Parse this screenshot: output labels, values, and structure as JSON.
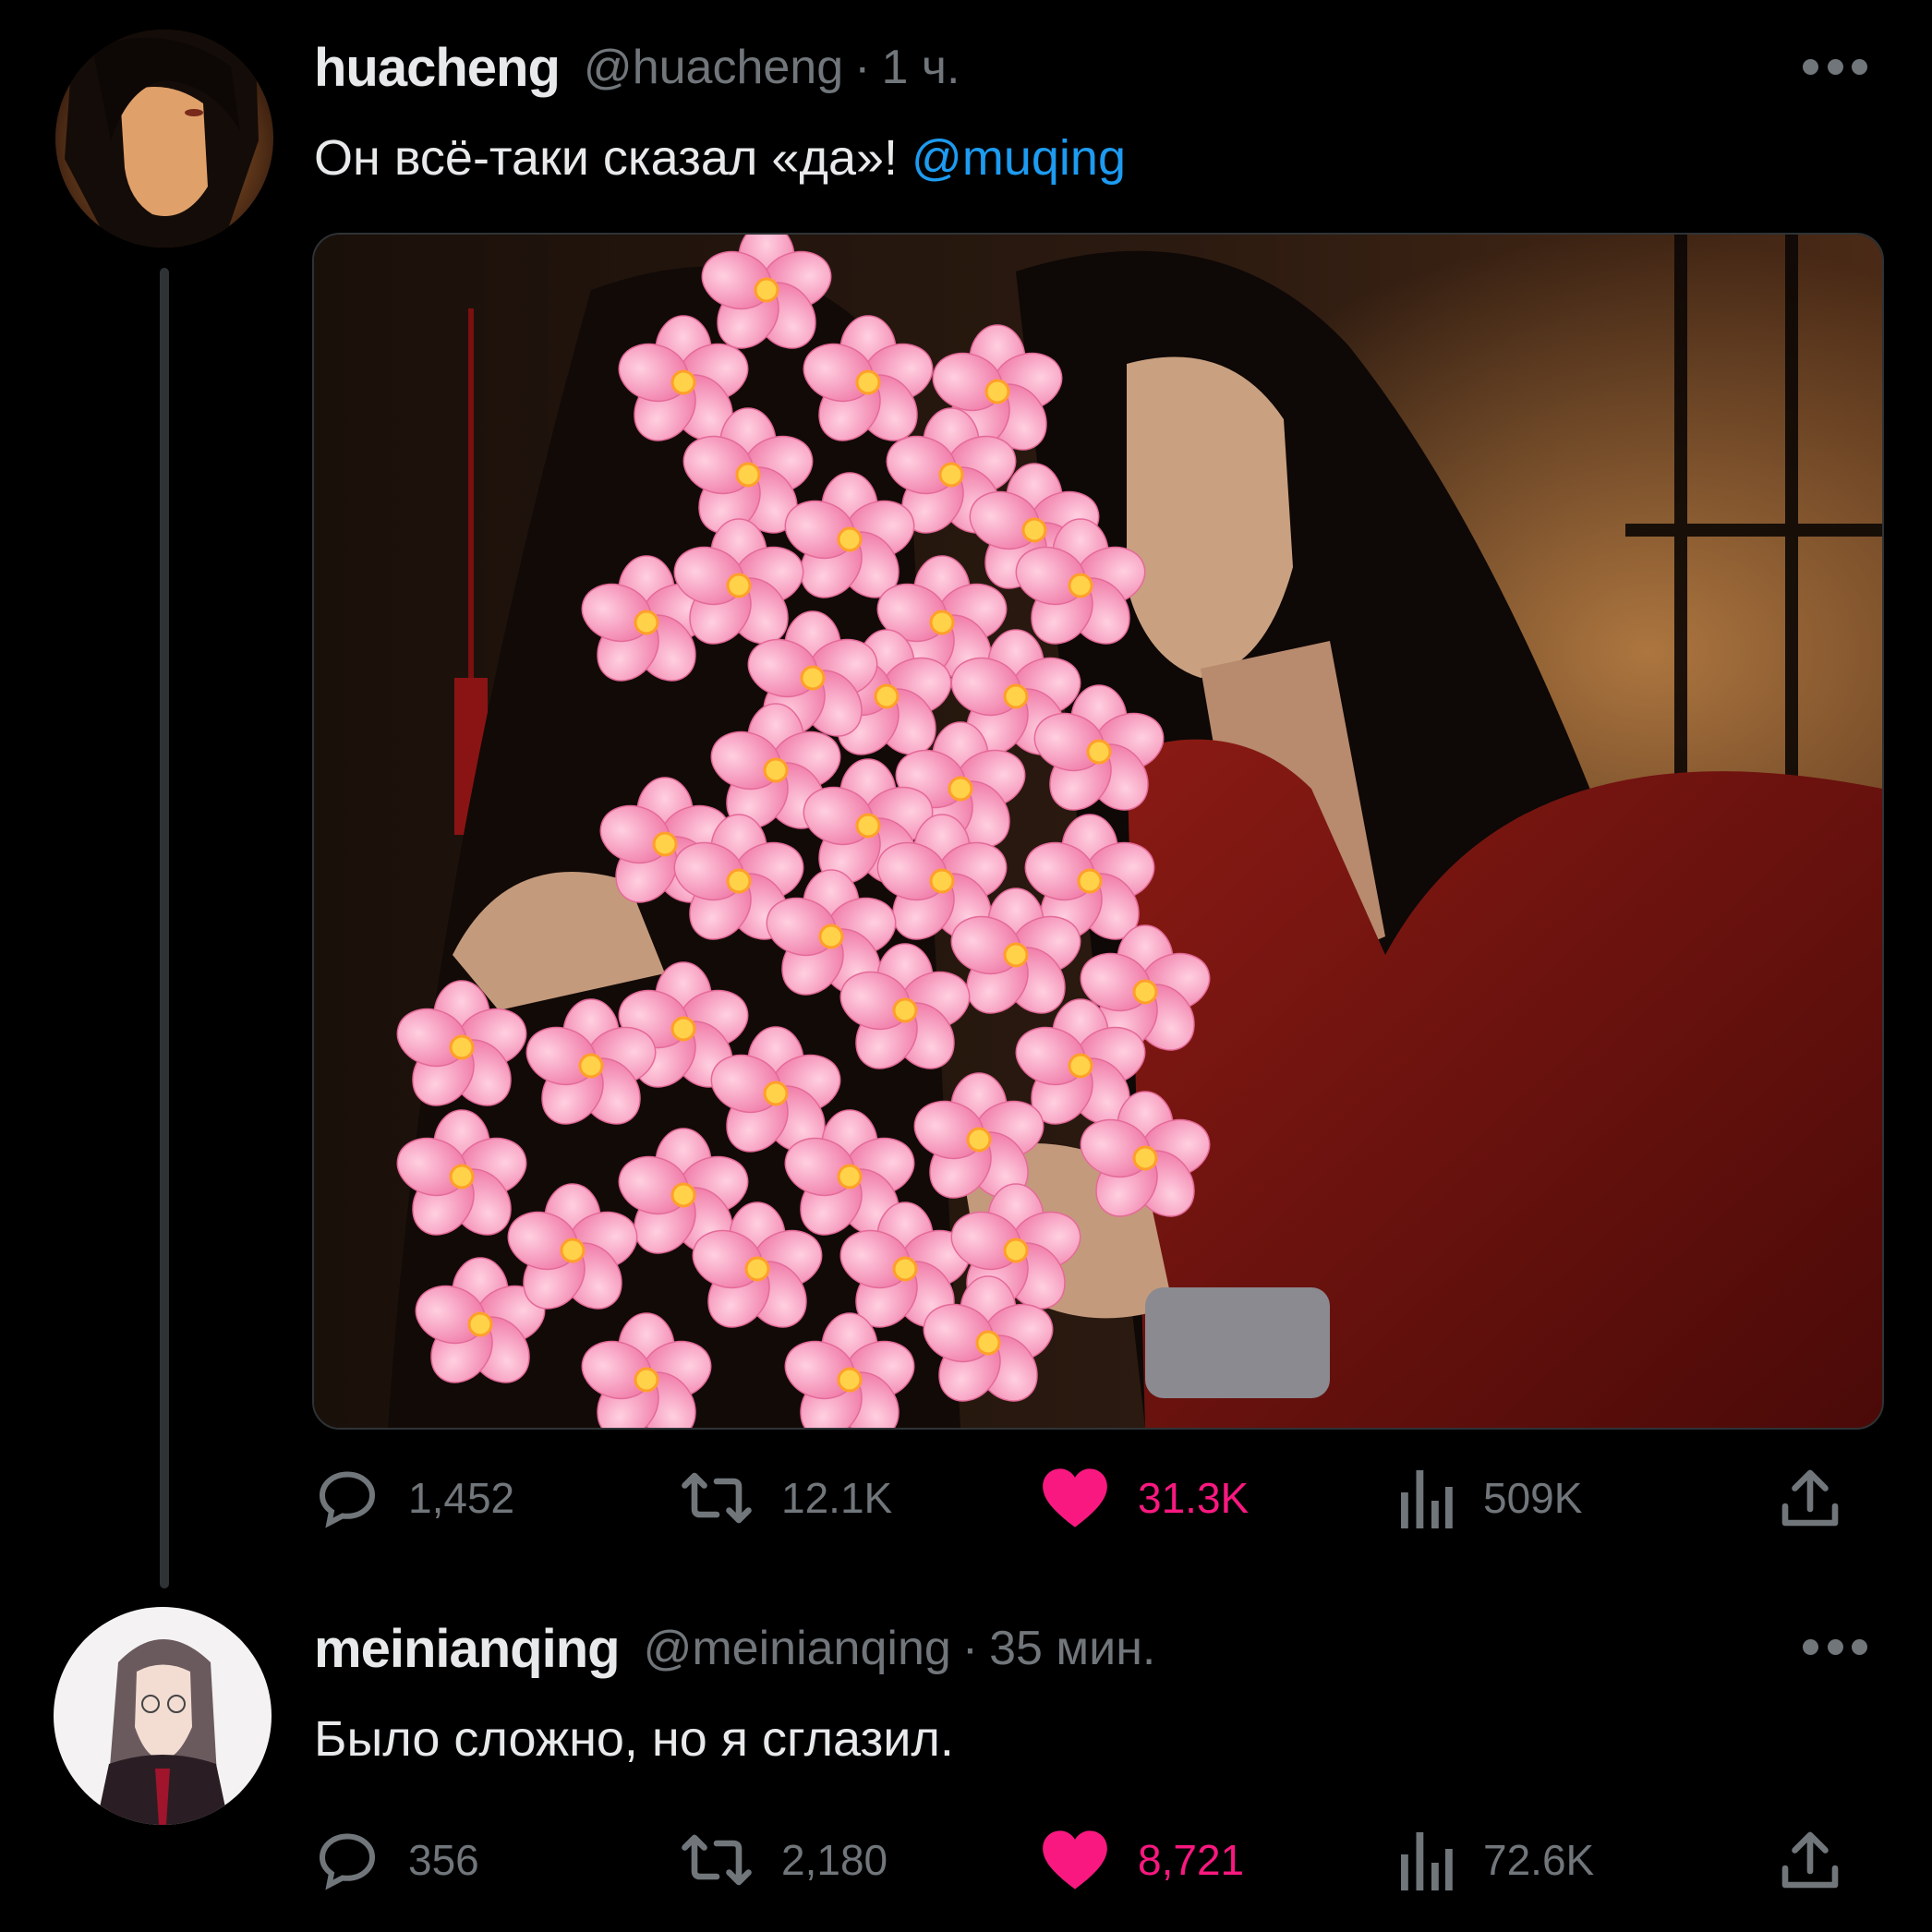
{
  "tweets": [
    {
      "display_name": "huacheng",
      "handle": "@huacheng",
      "separator": "·",
      "time": "1 ч.",
      "text": "Он всё-таки сказал «да»!",
      "mention": "@muqing",
      "stats": {
        "replies": "1,452",
        "retweets": "12.1K",
        "likes": "31.3K",
        "views": "509K"
      },
      "liked": true
    },
    {
      "display_name": "meinianqing",
      "handle": "@meinianqing",
      "separator": "·",
      "time": "35 мин.",
      "text": "Было сложно, но я сглазил.",
      "stats": {
        "replies": "356",
        "retweets": "2,180",
        "likes": "8,721",
        "views": "72.6K"
      },
      "liked": true
    }
  ],
  "colors": {
    "background": "#000000",
    "text": "#e7e9ea",
    "muted": "#71767b",
    "mention": "#1d9bf0",
    "like": "#f91880"
  },
  "icons": [
    "reply-icon",
    "retweet-icon",
    "heart-icon",
    "views-icon",
    "share-icon",
    "more-icon"
  ]
}
